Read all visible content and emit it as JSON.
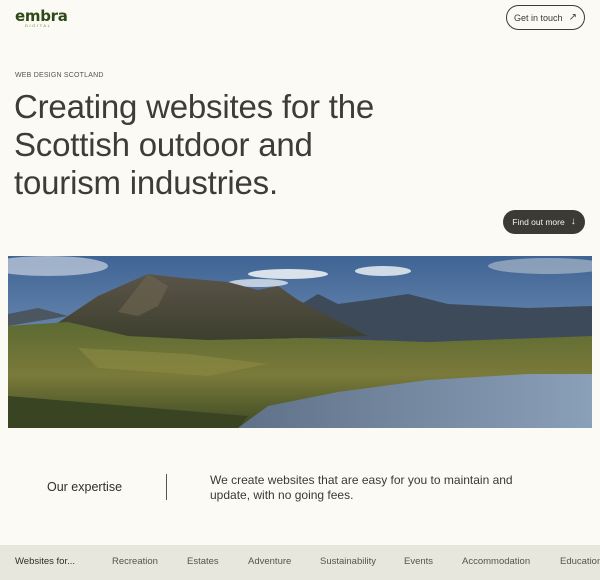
{
  "header": {
    "logo_word": "embra",
    "logo_sub": "DIGITAL",
    "contact_label": "Get in touch",
    "contact_icon": "arrow-up-right-icon"
  },
  "hero": {
    "eyebrow": "WEB DESIGN SCOTLAND",
    "headline": "Creating websites for the Scottish outdoor and tourism industries.",
    "cta_label": "Find out more",
    "cta_icon": "arrow-down-icon",
    "image_alt": "Scottish highland mountains and loch"
  },
  "expertise": {
    "heading": "Our expertise",
    "text": "We create websites that are easy for you to maintain and update, with no going fees."
  },
  "websites_for": {
    "label": "Websites for...",
    "tabs": [
      "Recreation",
      "Estates",
      "Adventure",
      "Sustainability",
      "Events",
      "Accommodation",
      "Education"
    ]
  },
  "colors": {
    "background": "#fbfaf4",
    "text": "#3b3b35",
    "button_dark": "#3b3b33",
    "logo_green": "#2e4a18",
    "bar_background": "#e8e7dd"
  }
}
